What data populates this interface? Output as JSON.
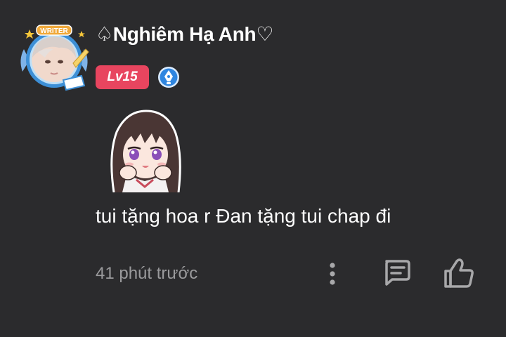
{
  "comment": {
    "author": {
      "name": "♤Nghiêm Hạ Anh♡",
      "avatar_label": "WRITER",
      "level": "Lv15",
      "badge_icon": "pen-nib-icon"
    },
    "sticker": "anime-girl-sticker",
    "text": "tui tặng hoa r Đan tặng tui chap đi",
    "timestamp": "41 phút trước",
    "actions": {
      "more_icon": "more-vertical-icon",
      "reply_icon": "comment-icon",
      "like_icon": "thumbs-up-icon"
    }
  },
  "colors": {
    "background": "#2b2b2d",
    "level_badge": "#e8455f",
    "timestamp": "#9a9a9c",
    "icon": "#a8a8aa"
  }
}
